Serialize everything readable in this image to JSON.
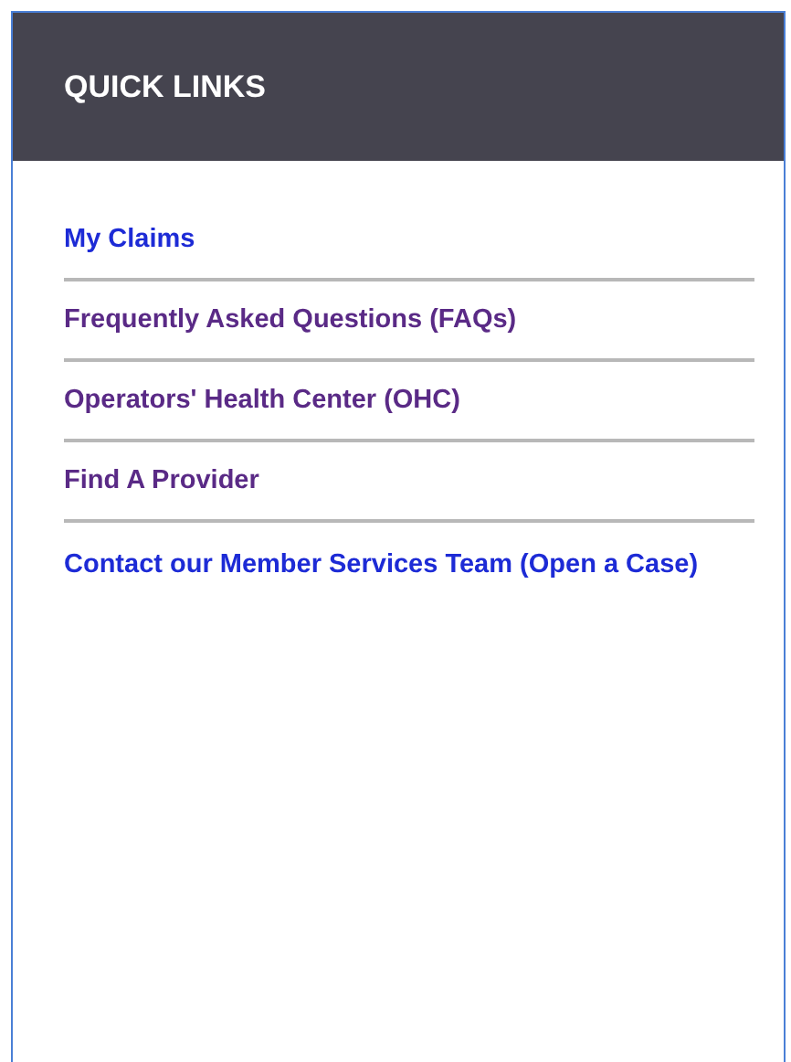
{
  "panel": {
    "title": "QUICK LINKS"
  },
  "links": [
    {
      "label": "My Claims",
      "visited": false
    },
    {
      "label": "Frequently Asked Questions (FAQs)",
      "visited": true
    },
    {
      "label": "Operators' Health Center (OHC)",
      "visited": true
    },
    {
      "label": "Find A Provider",
      "visited": true
    },
    {
      "label": "Contact our Member Services Team (Open a Case)",
      "visited": false
    }
  ]
}
